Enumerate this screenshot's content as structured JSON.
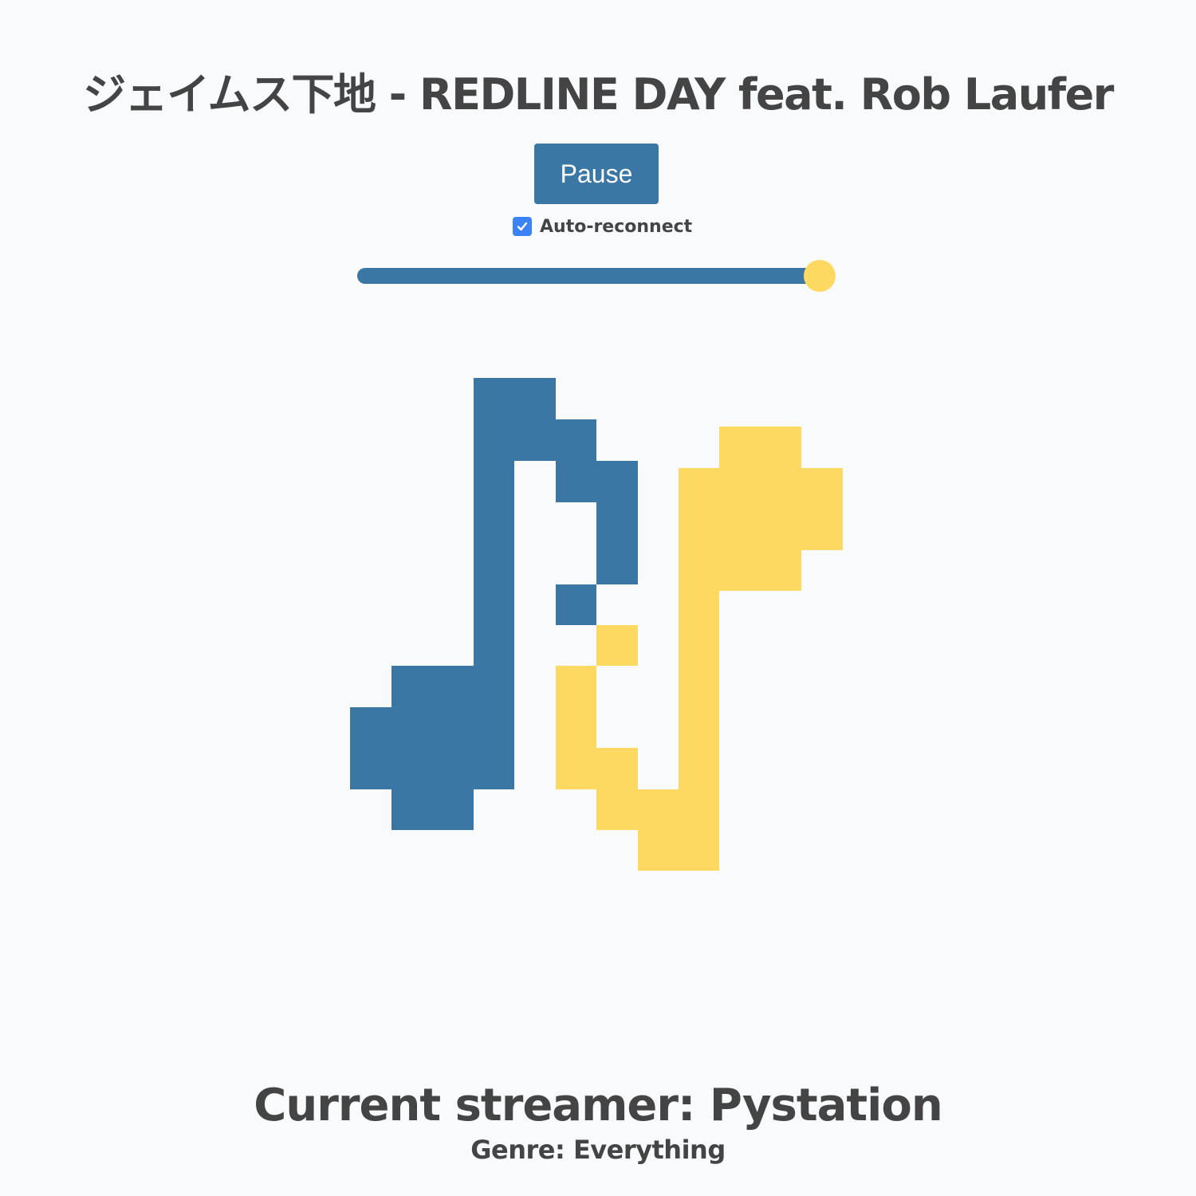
{
  "now_playing": {
    "title": "ジェイムス下地 - REDLINE DAY feat. Rob Laufer"
  },
  "controls": {
    "pause_label": "Pause",
    "auto_reconnect": {
      "label": "Auto-reconnect",
      "checked": true
    },
    "volume": {
      "value": 100,
      "max": 100
    }
  },
  "logo": {
    "icon": "music-note-logo-icon",
    "colors": {
      "blue": "#3b77a5",
      "yellow": "#fdd962"
    }
  },
  "station": {
    "streamer_text": "Current streamer: Pystation",
    "genre_text": "Genre: Everything"
  },
  "colors": {
    "background": "#f8fafc",
    "text": "#444444",
    "accent": "#3b77a5",
    "highlight": "#fdd962",
    "checkbox": "#3b82f6"
  }
}
